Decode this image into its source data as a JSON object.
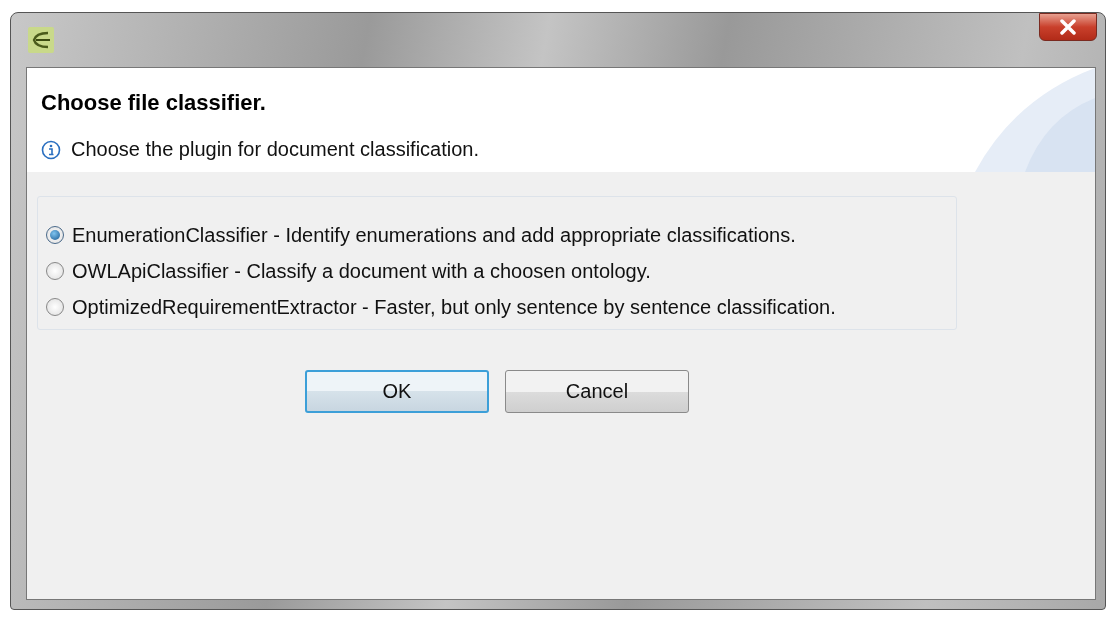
{
  "header": {
    "title": "Choose file classifier.",
    "message": "Choose the plugin for document classification."
  },
  "options": [
    {
      "label": "EnumerationClassifier - Identify enumerations and add appropriate classifications.",
      "selected": true
    },
    {
      "label": "OWLApiClassifier - Classify a document with a choosen ontology.",
      "selected": false
    },
    {
      "label": "OptimizedRequirementExtractor - Faster, but only sentence by sentence classification.",
      "selected": false
    }
  ],
  "buttons": [
    {
      "label": "OK",
      "default": true
    },
    {
      "label": "Cancel",
      "default": false
    }
  ]
}
